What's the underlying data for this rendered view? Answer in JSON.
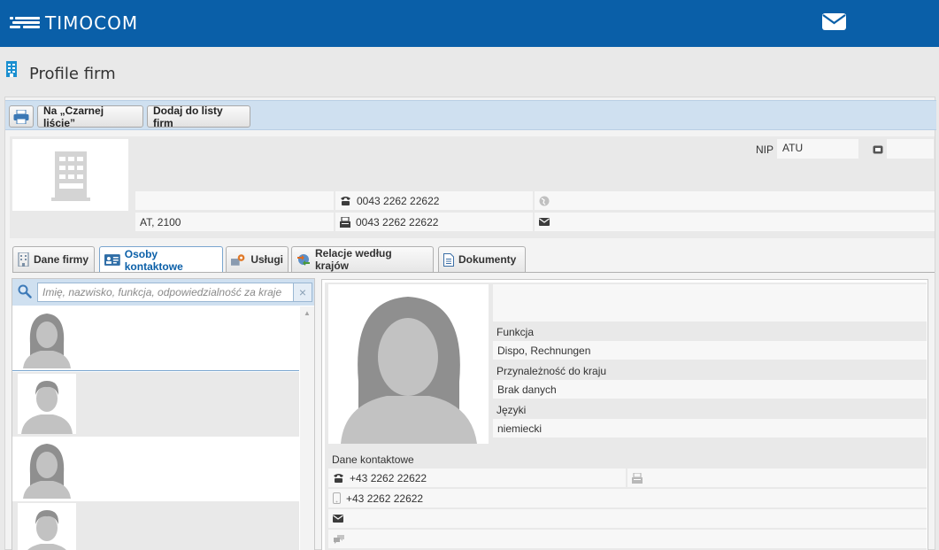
{
  "app": {
    "brand": "TIMOCOM",
    "mail_icon": "envelope-icon",
    "brand_color": "#0a5fa8"
  },
  "page": {
    "title": "Profile firm",
    "icon": "building-icon"
  },
  "toolbar": {
    "print_icon": "printer-icon",
    "blacklist_label": "Na „Czarnej liście”",
    "add_list_label": "Dodaj do listy firm"
  },
  "company": {
    "nip_label": "NIP",
    "nip_value": "ATU",
    "name_line": "",
    "address": "AT, 2100",
    "phone": "0043 2262 22622",
    "fax": "0043 2262 22622",
    "website": "",
    "email": ""
  },
  "tabs": [
    {
      "label": "Dane firmy",
      "icon": "building-icon"
    },
    {
      "label": "Osoby kontaktowe",
      "icon": "contact-card-icon",
      "active": true
    },
    {
      "label": "Usługi",
      "icon": "services-icon"
    },
    {
      "label": "Relacje według krajów",
      "icon": "globe-arrows-icon"
    },
    {
      "label": "Dokumenty",
      "icon": "document-icon"
    }
  ],
  "contacts": {
    "search_placeholder": "Imię, nazwisko, funkcja, odpowiedzialność za kraje",
    "clear_label": "×",
    "scroll_up": "▲",
    "items": [
      {
        "avatar": "female-avatar",
        "name": ""
      },
      {
        "avatar": "male-avatar",
        "name": ""
      },
      {
        "avatar": "female-avatar",
        "name": ""
      },
      {
        "avatar": "male-avatar",
        "name": ""
      }
    ]
  },
  "detail": {
    "name": "",
    "function_label": "Funkcja",
    "function_value": "Dispo, Rechnungen",
    "country_label": "Przynależność do kraju",
    "country_value": "Brak danych",
    "languages_label": "Języki",
    "languages_value": "niemiecki",
    "contact_label": "Dane kontaktowe",
    "phone": "+43 2262 22622",
    "fax": "",
    "mobile": "+43 2262 22622",
    "email": "",
    "messenger": ""
  }
}
